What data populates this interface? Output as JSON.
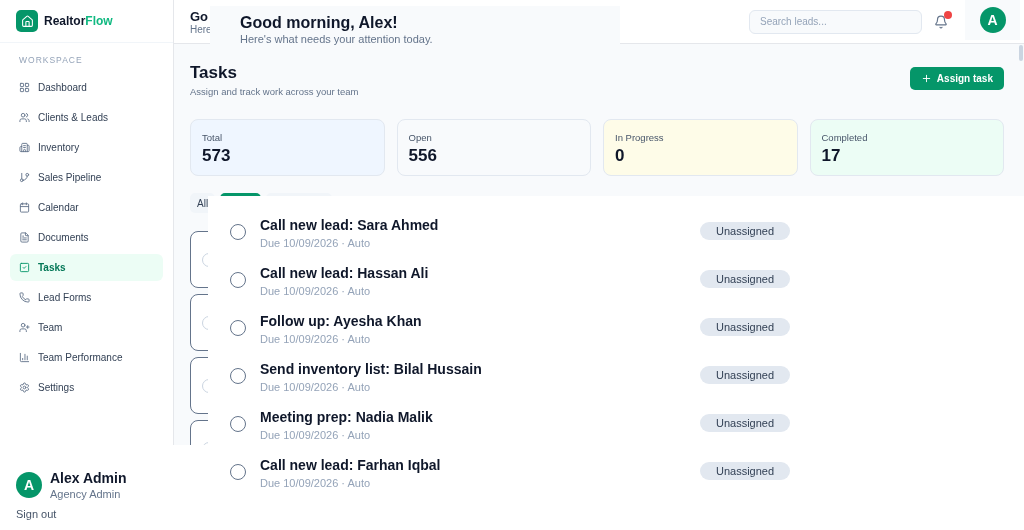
{
  "brand": {
    "name": "Realtor",
    "accent": "Flow"
  },
  "sidebar": {
    "section": "WORKSPACE",
    "items": [
      {
        "label": "Dashboard",
        "selected": false
      },
      {
        "label": "Clients & Leads",
        "selected": false
      },
      {
        "label": "Inventory",
        "selected": false
      },
      {
        "label": "Sales Pipeline",
        "selected": false
      },
      {
        "label": "Calendar",
        "selected": false
      },
      {
        "label": "Documents",
        "selected": false
      },
      {
        "label": "Tasks",
        "selected": true
      },
      {
        "label": "Lead Forms",
        "selected": false
      },
      {
        "label": "Team",
        "selected": false
      },
      {
        "label": "Team Performance",
        "selected": false
      },
      {
        "label": "Settings",
        "selected": false
      }
    ]
  },
  "header": {
    "title": "Go",
    "subtitle": "Here",
    "search": {
      "placeholder": "Search leads..."
    },
    "avatar": "A"
  },
  "greeting": {
    "title": "Good morning, Alex!",
    "subtitle": "Here's what needs your attention today."
  },
  "page": {
    "title": "Tasks",
    "subtitle": "Assign and track work across your team",
    "action": "Assign task"
  },
  "stats": [
    {
      "label": "Total",
      "value": "573",
      "color": "#eff6ff"
    },
    {
      "label": "Open",
      "value": "556",
      "color": "#f8fafc"
    },
    {
      "label": "In Progress",
      "value": "0",
      "color": "#fefce8"
    },
    {
      "label": "Completed",
      "value": "17",
      "color": "#ecfdf5"
    }
  ],
  "filters": [
    {
      "label": "All",
      "selected": false
    },
    {
      "selected": true
    },
    {
      "selected": false
    }
  ],
  "tasks": [
    {
      "title": "Call new lead: Sara Ahmed",
      "meta": "Due 10/09/2026 · Auto",
      "assignee": "Unassigned",
      "done": false
    },
    {
      "title": "Call new lead: Hassan Ali",
      "meta": "Due 10/09/2026 · Auto",
      "assignee": "Unassigned",
      "done": false
    },
    {
      "title": "Follow up: Ayesha Khan",
      "meta": "Due 10/09/2026 · Auto",
      "assignee": "Unassigned",
      "done": false
    },
    {
      "title": "Send inventory list: Bilal Hussain",
      "meta": "Due 10/09/2026 · Auto",
      "assignee": "Unassigned",
      "done": false
    },
    {
      "title": "Meeting prep: Nadia Malik",
      "meta": "Due 10/09/2026 · Auto",
      "assignee": "Unassigned",
      "done": false
    },
    {
      "title": "Call new lead: Farhan Iqbal",
      "meta": "Due 10/09/2026 · Auto",
      "assignee": "Unassigned",
      "done": false
    }
  ],
  "user": {
    "initial": "A",
    "name": "Alex Admin",
    "role": "Agency Admin",
    "sign_out": "Sign out"
  }
}
